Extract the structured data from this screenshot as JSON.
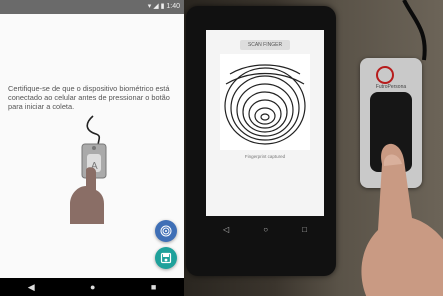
{
  "app": {
    "status_icons": "▾ ◢ ▮ 1:40",
    "instruction": "Certifique-se de que o dispositivo biométrico está conectado ao celular antes de pressionar o botão para iniciar a coleta.",
    "fab_fingerprint_icon": "fingerprint-icon",
    "fab_save_icon": "save-icon",
    "nav": [
      "◀",
      "●",
      "■"
    ]
  },
  "photo": {
    "scan_button_label": "SCAN FINGER",
    "fingerprint_caption": "Fingerprint captured",
    "phone_nav": [
      "◁",
      "○",
      "□"
    ],
    "reader_brand": "FutroPersona"
  },
  "colors": {
    "fab_fingerprint": "#3f6fb6",
    "fab_save": "#1fa19b",
    "status_bar": "#6a6a6a",
    "nav_bar": "#000000"
  }
}
